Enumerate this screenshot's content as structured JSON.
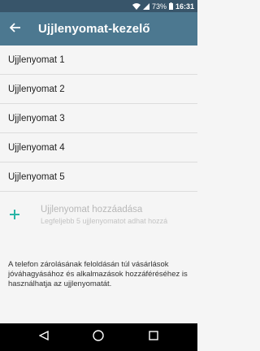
{
  "status_bar": {
    "battery": "73%",
    "time": "16:31",
    "icons": [
      "wifi-icon",
      "signal-icon",
      "battery-icon"
    ]
  },
  "app_bar": {
    "title": "Ujjlenyomat-kezelő",
    "back_icon": "arrow-left-icon"
  },
  "fingerprints": [
    {
      "label": "Ujjlenyomat 1"
    },
    {
      "label": "Ujjlenyomat 2"
    },
    {
      "label": "Ujjlenyomat 3"
    },
    {
      "label": "Ujjlenyomat 4"
    },
    {
      "label": "Ujjlenyomat 5"
    }
  ],
  "add_fingerprint": {
    "icon": "plus-icon",
    "title": "Ujjlenyomat hozzáadása",
    "subtitle": "Legfeljebb 5 ujjlenyomatot adhat hozzá"
  },
  "info_text": "A telefon zárolásának feloldásán túl vásárlások jóváhagyásához és alkalmazások hozzáféréséhez is használhatja az ujjlenyomatát.",
  "nav_bar": {
    "buttons": [
      "back-triangle-icon",
      "home-circle-icon",
      "recents-square-icon"
    ]
  },
  "colors": {
    "status_bar": "#38556a",
    "app_bar": "#4c7890",
    "accent": "#2ab5a6",
    "background": "#f5f5f5"
  }
}
